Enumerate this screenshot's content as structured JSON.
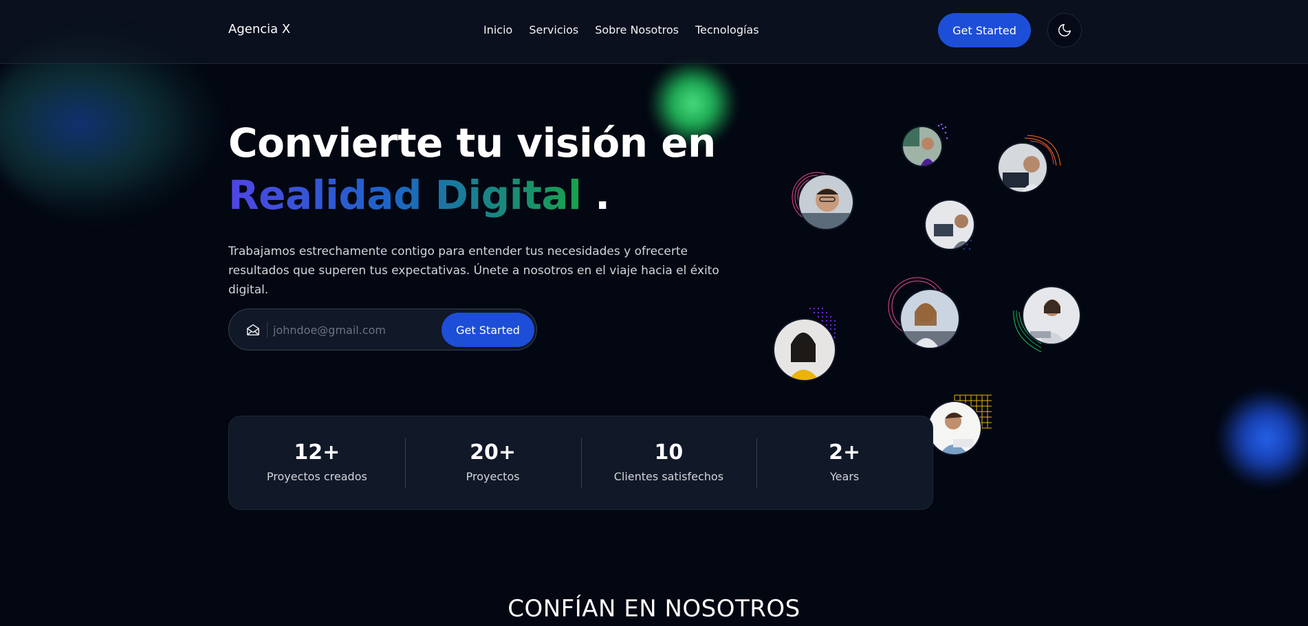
{
  "header": {
    "brand": "Agencia X",
    "nav": [
      "Inicio",
      "Servicios",
      "Sobre Nosotros",
      "Tecnologías"
    ],
    "cta_label": "Get Started",
    "theme_toggle_icon": "moon-icon"
  },
  "hero": {
    "title_line1": "Convierte tu visión en",
    "title_gradient": "Realidad Digital",
    "title_suffix": ".",
    "description": "Trabajamos estrechamente contigo para entender tus necesidades y ofrecerte resultados que superen tus expectativas. Únete a nosotros en el viaje hacia el éxito digital.",
    "email_placeholder": "johndoe@gmail.com",
    "email_icon": "mail-open-icon",
    "cta_label": "Get Started"
  },
  "stats": [
    {
      "value": "12+",
      "label": "Proyectos creados"
    },
    {
      "value": "20+",
      "label": "Proyectos"
    },
    {
      "value": "10",
      "label": "Clientes satisfechos"
    },
    {
      "value": "2+",
      "label": "Years"
    }
  ],
  "trust_title": "CONFÍAN EN NOSOTROS",
  "colors": {
    "background": "#030712",
    "primary": "#1d4ed8",
    "glow_green": "#4ade80",
    "glow_blue": "#2563eb"
  }
}
